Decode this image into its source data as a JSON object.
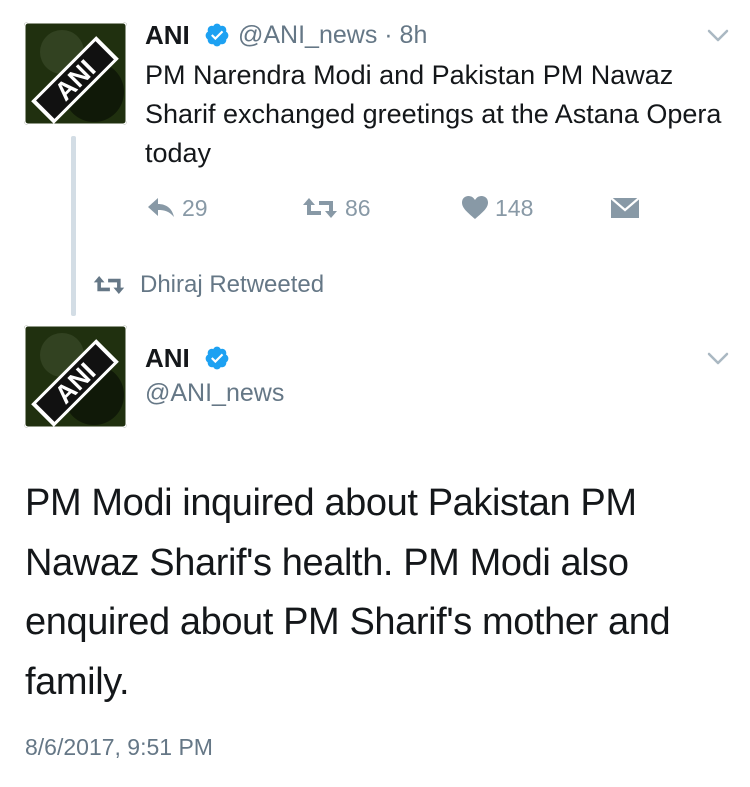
{
  "quoted_tweet": {
    "author_name": "ANI",
    "handle_time": "@ANI_news · 8h",
    "text": "PM Narendra Modi and Pakistan PM Nawaz Sharif exchanged greetings at the Astana Opera today",
    "reply_count": "29",
    "retweet_count": "86",
    "like_count": "148",
    "avatar_text": "ANI"
  },
  "retweet_context": {
    "label": "Dhiraj Retweeted"
  },
  "main_tweet": {
    "author_name": "ANI",
    "handle": "@ANI_news",
    "text": "PM Modi inquired about Pakistan PM Nawaz Sharif's health. PM Modi also enquired about PM Sharif's mother and family.",
    "timestamp": "8/6/2017, 9:51 PM",
    "avatar_text": "ANI"
  },
  "colors": {
    "primary_text": "#14171a",
    "secondary_text": "#657786",
    "action_gray": "#8899a6",
    "verified_blue": "#1da1f2",
    "thread_line": "#d3dde5"
  },
  "icons": [
    "reply-icon",
    "retweet-icon",
    "heart-icon",
    "envelope-icon",
    "verified-badge-icon",
    "chevron-down-icon"
  ]
}
